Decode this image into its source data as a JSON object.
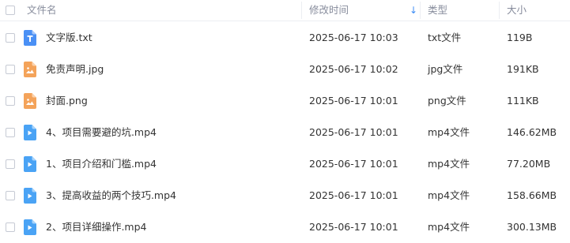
{
  "header": {
    "name": "文件名",
    "modified": "修改时间",
    "sort_icon": "sort-descending-arrow",
    "type": "类型",
    "size": "大小"
  },
  "colors": {
    "txt": "#4a90f5",
    "image": "#f4a35a",
    "video": "#4aa3f5",
    "accent": "#3b8cf5"
  },
  "files": [
    {
      "name": "文字版.txt",
      "modified": "2025-06-17 10:03",
      "type": "txt文件",
      "size": "119B",
      "icon": "txt-file-icon"
    },
    {
      "name": "免责声明.jpg",
      "modified": "2025-06-17 10:02",
      "type": "jpg文件",
      "size": "191KB",
      "icon": "image-file-icon"
    },
    {
      "name": "封面.png",
      "modified": "2025-06-17 10:01",
      "type": "png文件",
      "size": "111KB",
      "icon": "image-file-icon"
    },
    {
      "name": "4、项目需要避的坑.mp4",
      "modified": "2025-06-17 10:01",
      "type": "mp4文件",
      "size": "146.62MB",
      "icon": "video-file-icon"
    },
    {
      "name": "1、项目介绍和门槛.mp4",
      "modified": "2025-06-17 10:01",
      "type": "mp4文件",
      "size": "77.20MB",
      "icon": "video-file-icon"
    },
    {
      "name": "3、提高收益的两个技巧.mp4",
      "modified": "2025-06-17 10:01",
      "type": "mp4文件",
      "size": "158.66MB",
      "icon": "video-file-icon"
    },
    {
      "name": "2、项目详细操作.mp4",
      "modified": "2025-06-17 10:01",
      "type": "mp4文件",
      "size": "300.13MB",
      "icon": "video-file-icon"
    }
  ]
}
